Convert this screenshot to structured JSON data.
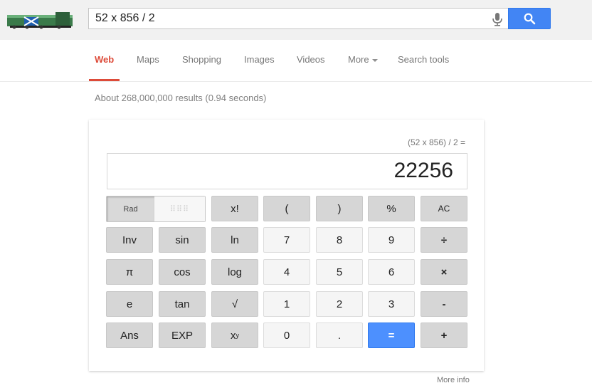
{
  "search": {
    "query": "52 x 856 / 2"
  },
  "tabs": [
    {
      "label": "Web"
    },
    {
      "label": "Maps"
    },
    {
      "label": "Shopping"
    },
    {
      "label": "Images"
    },
    {
      "label": "Videos"
    },
    {
      "label": "More"
    },
    {
      "label": "Search tools"
    }
  ],
  "results_stats": "About 268,000,000 results (0.94 seconds)",
  "calculator": {
    "expression": "(52 x 856) / 2 =",
    "result": "22256",
    "rad_label": "Rad",
    "deg_label": "⠿⠿⠿",
    "keys": {
      "fact": "x!",
      "lparen": "(",
      "rparen": ")",
      "percent": "%",
      "ac": "AC",
      "inv": "Inv",
      "sin": "sin",
      "ln": "ln",
      "seven": "7",
      "eight": "8",
      "nine": "9",
      "divide": "÷",
      "pi": "π",
      "cos": "cos",
      "log": "log",
      "four": "4",
      "five": "5",
      "six": "6",
      "multiply": "×",
      "e": "e",
      "tan": "tan",
      "sqrt": "√",
      "one": "1",
      "two": "2",
      "three": "3",
      "minus": "-",
      "ans": "Ans",
      "exp": "EXP",
      "power_base": "x",
      "power_exp": "y",
      "zero": "0",
      "dot": ".",
      "equals": "=",
      "plus": "+"
    }
  },
  "more_info": "More info",
  "colors": {
    "accent_red": "#dd4b39",
    "search_blue": "#4285f4",
    "equals_blue": "#4d90fe"
  }
}
